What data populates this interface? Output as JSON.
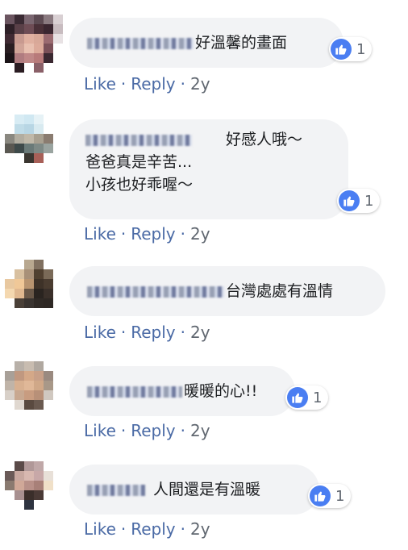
{
  "comments": [
    {
      "text_lines": [
        "好溫馨的畫面"
      ],
      "reaction_count": "1",
      "actions": {
        "like": "Like",
        "reply": "Reply",
        "separator": "·",
        "time": "2y"
      }
    },
    {
      "text_lines": [
        "好感人哦～",
        "爸爸真是辛苦...",
        "小孩也好乖喔～"
      ],
      "reaction_count": "1",
      "actions": {
        "like": "Like",
        "reply": "Reply",
        "separator": "·",
        "time": "2y"
      }
    },
    {
      "text_lines": [
        "台灣處處有溫情"
      ],
      "reaction_count": "",
      "actions": {
        "like": "Like",
        "reply": "Reply",
        "separator": "·",
        "time": "2y"
      }
    },
    {
      "text_lines": [
        "暖暖的心!!"
      ],
      "reaction_count": "1",
      "actions": {
        "like": "Like",
        "reply": "Reply",
        "separator": "·",
        "time": "2y"
      }
    },
    {
      "text_lines": [
        "人間還是有溫暖"
      ],
      "reaction_count": "1",
      "actions": {
        "like": "Like",
        "reply": "Reply",
        "separator": "·",
        "time": "2y"
      }
    }
  ],
  "reaction_icon": "thumbs-up-icon",
  "colors": {
    "bubble": "#f2f3f5",
    "link": "#4a6aa5",
    "like_icon": "#4a7ef2"
  }
}
